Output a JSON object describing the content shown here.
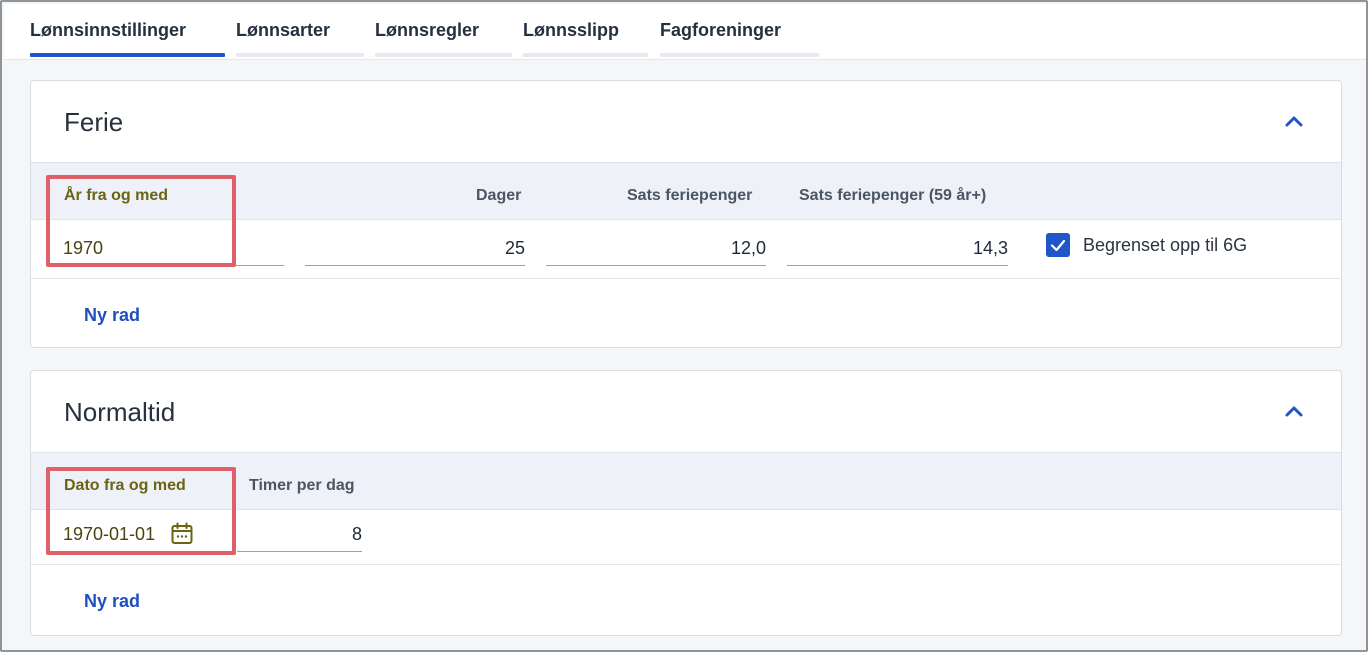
{
  "tabs": [
    {
      "label": "Lønnsinnstillinger",
      "active": true
    },
    {
      "label": "Lønnsarter",
      "active": false
    },
    {
      "label": "Lønnsregler",
      "active": false
    },
    {
      "label": "Lønnsslipp",
      "active": false
    },
    {
      "label": "Fagforeninger",
      "active": false
    }
  ],
  "ferie": {
    "title": "Ferie",
    "collapse_icon": "chevron-up-icon",
    "columns": [
      "År fra og med",
      "Dager",
      "Sats feriepenger",
      "Sats feriepenger (59 år+)"
    ],
    "row": {
      "year_from": "1970",
      "days": "25",
      "rate": "12,0",
      "rate_59": "14,3",
      "limited_checked": true,
      "limited_label": "Begrenset opp til 6G"
    },
    "new_row_label": "Ny rad"
  },
  "normaltid": {
    "title": "Normaltid",
    "collapse_icon": "chevron-up-icon",
    "columns": [
      "Dato fra og med",
      "Timer per dag"
    ],
    "row": {
      "date_from": "1970-01-01",
      "hours_per_day": "8"
    },
    "calendar_icon": "calendar-icon",
    "new_row_label": "Ny rad"
  },
  "colors": {
    "accent": "#1f56c8",
    "highlight": "#e0606a",
    "header_bg": "#eef1f7"
  }
}
